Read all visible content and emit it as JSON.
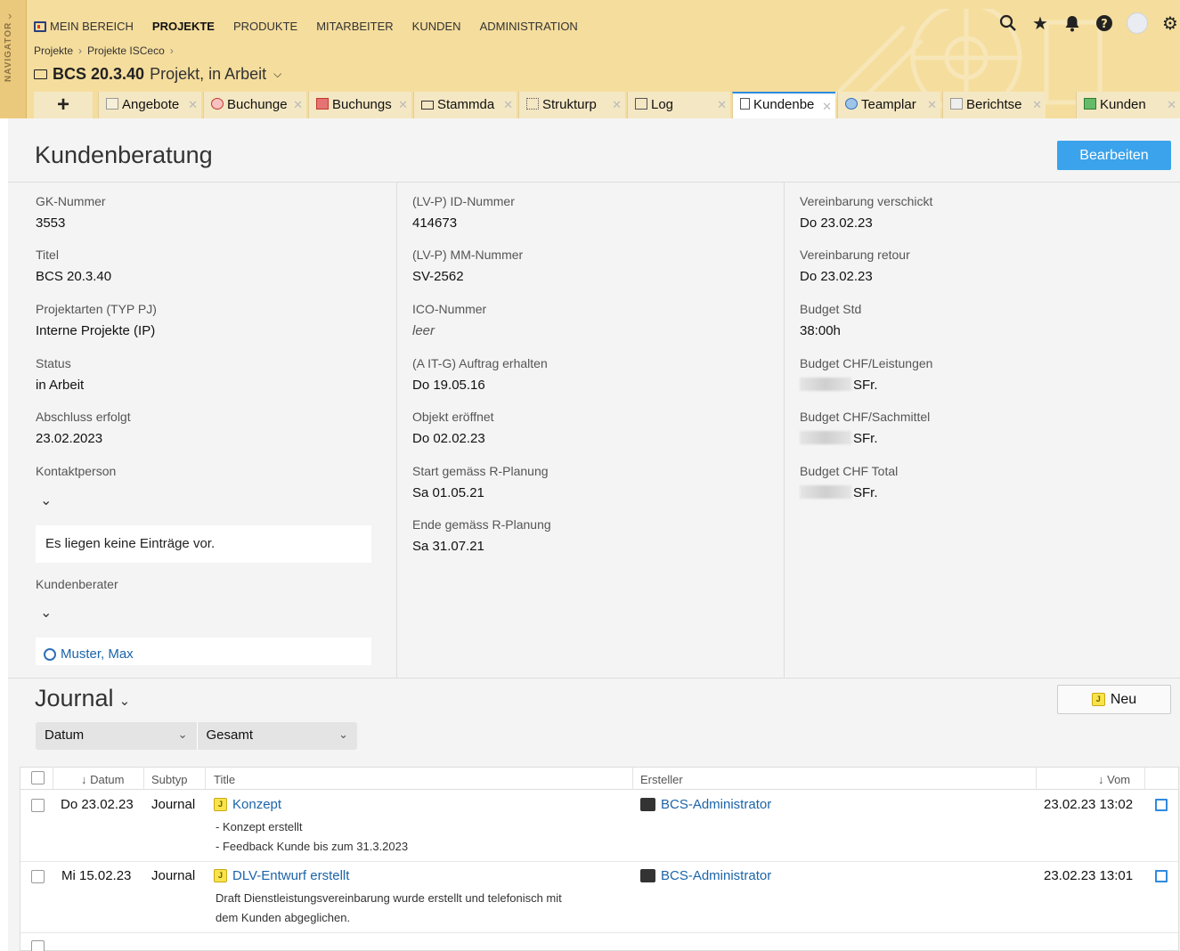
{
  "app": {
    "navigator_label": "NAVIGATOR",
    "top_menu": [
      "MEIN BEREICH",
      "PROJEKTE",
      "PRODUKTE",
      "MITARBEITER",
      "KUNDEN",
      "ADMINISTRATION"
    ],
    "active_menu": "PROJEKTE",
    "top_icons": [
      "search-icon",
      "star-icon",
      "bell-icon",
      "help-icon",
      "avatar",
      "gear-icon"
    ]
  },
  "breadcrumb": [
    "Projekte",
    "Projekte ISCeco"
  ],
  "object": {
    "code": "BCS 20.3.40",
    "subtitle": "Projekt, in Arbeit"
  },
  "tabs": [
    {
      "label": "Angebote",
      "icon": "offer-icon"
    },
    {
      "label": "Buchunge",
      "icon": "booking-icon"
    },
    {
      "label": "Buchungs",
      "icon": "booking-chart-icon"
    },
    {
      "label": "Stammda",
      "icon": "folder-icon"
    },
    {
      "label": "Strukturp",
      "icon": "structure-icon"
    },
    {
      "label": "Log",
      "icon": "log-icon"
    },
    {
      "label": "Kundenbe",
      "icon": "document-icon",
      "active": true
    },
    {
      "label": "Teamplar",
      "icon": "team-icon"
    },
    {
      "label": "Berichtse",
      "icon": "report-icon"
    },
    {
      "label": "Kunden",
      "icon": "customer-icon"
    }
  ],
  "page": {
    "title": "Kundenberatung",
    "edit_label": "Bearbeiten"
  },
  "details": {
    "col1": [
      {
        "label": "GK-Nummer",
        "value": "3553"
      },
      {
        "label": "Titel",
        "value": "BCS 20.3.40"
      },
      {
        "label": "Projektarten (TYP PJ)",
        "value": "Interne Projekte (IP)"
      },
      {
        "label": "Status",
        "value": "in Arbeit"
      },
      {
        "label": "Abschluss erfolgt",
        "value": "23.02.2023"
      }
    ],
    "contact_label": "Kontaktperson",
    "contact_empty": "Es liegen keine Einträge vor.",
    "advisor_label": "Kundenberater",
    "advisor_name": "Muster, Max",
    "col2": [
      {
        "label": "(LV-P) ID-Nummer",
        "value": "414673"
      },
      {
        "label": "(LV-P) MM-Nummer",
        "value": "SV-2562"
      },
      {
        "label": "ICO-Nummer",
        "value": "leer",
        "empty": true
      },
      {
        "label": "(A IT-G) Auftrag erhalten",
        "value": "Do 19.05.16"
      },
      {
        "label": "Objekt eröffnet",
        "value": "Do 02.02.23"
      },
      {
        "label": "Start gemäss R-Planung",
        "value": "Sa 01.05.21"
      },
      {
        "label": "Ende gemäss R-Planung",
        "value": "Sa 31.07.21"
      }
    ],
    "col3": [
      {
        "label": "Vereinbarung verschickt",
        "value": "Do 23.02.23"
      },
      {
        "label": "Vereinbarung retour",
        "value": "Do 23.02.23"
      },
      {
        "label": "Budget Std",
        "value": "38:00h"
      },
      {
        "label": "Budget CHF/Leistungen",
        "value": "SFr.",
        "blurred": true
      },
      {
        "label": "Budget CHF/Sachmittel",
        "value": "SFr.",
        "blurred": true
      },
      {
        "label": "Budget CHF Total",
        "value": "SFr.",
        "blurred": true
      }
    ]
  },
  "journal": {
    "title": "Journal",
    "new_label": "Neu",
    "filters": [
      "Datum",
      "Gesamt"
    ],
    "columns": {
      "datum": "Datum",
      "subtyp": "Subtyp",
      "title": "Title",
      "ersteller": "Ersteller",
      "vom": "Vom"
    },
    "rows": [
      {
        "datum": "Do 23.02.23",
        "subtyp": "Journal",
        "title": "Konzept",
        "desc": [
          "- Konzept erstellt",
          "- Feedback Kunde bis zum 31.3.2023"
        ],
        "ersteller": "BCS-Administrator",
        "vom": "23.02.23 13:02"
      },
      {
        "datum": "Mi 15.02.23",
        "subtyp": "Journal",
        "title": "DLV-Entwurf erstellt",
        "desc": [
          "Draft Dienstleistungsvereinbarung wurde erstellt und telefonisch mit",
          "dem Kunden abgeglichen."
        ],
        "ersteller": "BCS-Administrator",
        "vom": "23.02.23 13:01"
      }
    ]
  },
  "colors": {
    "header_bg": "#f5dd9d",
    "accent": "#3aa3ec",
    "link": "#1b64a8",
    "content_bg": "#f4f4f4"
  }
}
